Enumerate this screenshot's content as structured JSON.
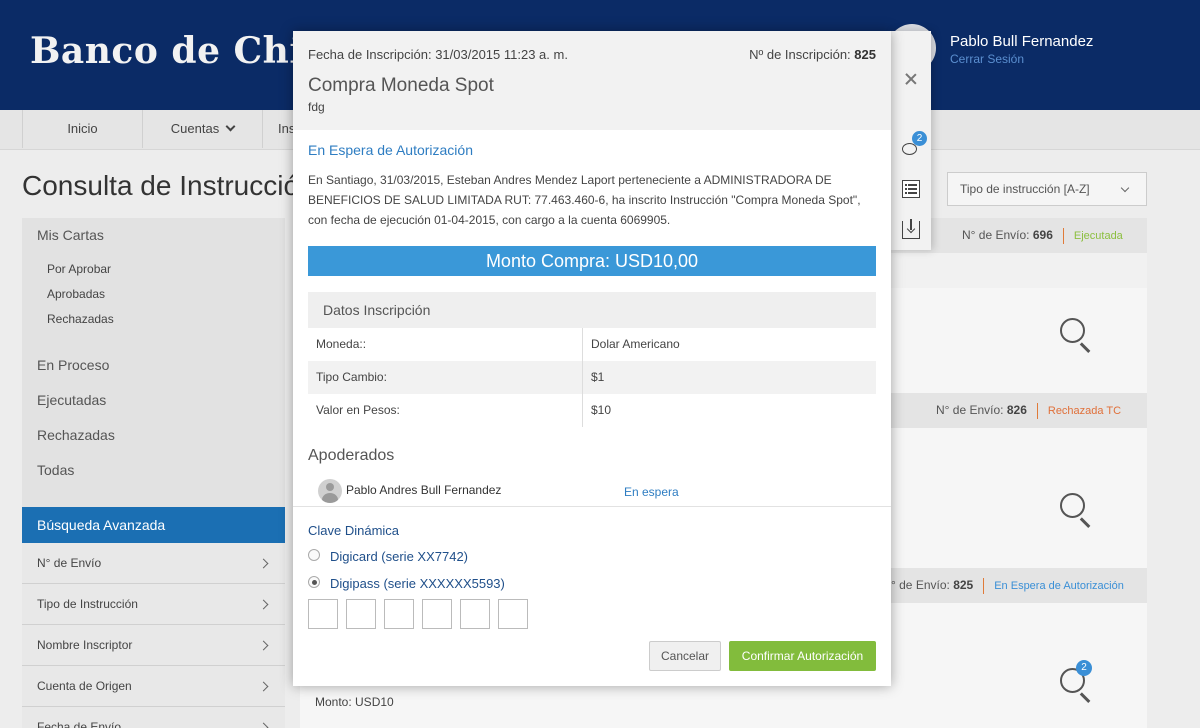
{
  "header": {
    "bank_name": "Banco de Chile",
    "user_name": "Pablo Bull Fernandez",
    "logout_label": "Cerrar Sesión"
  },
  "nav": {
    "items": [
      "Inicio",
      "Cuentas",
      "Ins"
    ]
  },
  "page": {
    "title": "Consulta de Instrucción",
    "filter_select": "Tipo de instrucción [A-Z]"
  },
  "sidebar": {
    "mis_cartas": "Mis Cartas",
    "sub_items": [
      "Por Aprobar",
      "Aprobadas",
      "Rechazadas"
    ],
    "groups": [
      "En Proceso",
      "Ejecutadas",
      "Rechazadas",
      "Todas"
    ],
    "advanced_title": "Búsqueda Avanzada",
    "advanced_items": [
      "N° de Envío",
      "Tipo de Instrucción",
      "Nombre Inscriptor",
      "Cuenta de Origen",
      "Fecha de Envío"
    ]
  },
  "cards": [
    {
      "envio_label": "N° de Envío:",
      "envio_num": "696",
      "status": "Ejecutada",
      "status_color": "#8cbf3f"
    },
    {
      "envio_label": "N° de Envío:",
      "envio_num": "826",
      "status": "Rechazada TC",
      "status_color": "#e0703a"
    },
    {
      "envio_label": "° de Envío:",
      "envio_num": "825",
      "status": "En Espera de Autorización",
      "status_color": "#3a8fd6"
    }
  ],
  "card_badge": "2",
  "background_monto": "Monto: USD10",
  "modal": {
    "fecha_label": "Fecha de Inscripción:",
    "fecha_value": "31/03/2015 11:23 a. m.",
    "num_label": "Nº de Inscripción:",
    "num_value": "825",
    "title": "Compra Moneda Spot",
    "subtitle": "fdg",
    "status": "En Espera de Autorización",
    "description": "En Santiago, 31/03/2015, Esteban Andres Mendez Laport perteneciente a ADMINISTRADORA DE BENEFICIOS DE SALUD LIMITADA RUT: 77.463.460-6, ha inscrito Instrucción \"Compra Moneda Spot\", con fecha de ejecución 01-04-2015, con cargo a la cuenta 6069905.",
    "amount_banner": "Monto Compra: USD10,00",
    "datos_title": "Datos Inscripción",
    "datos_rows": [
      {
        "key": "Moneda::",
        "value": "Dolar Americano"
      },
      {
        "key": "Tipo Cambio:",
        "value": "$1"
      },
      {
        "key": "Valor en Pesos:",
        "value": "$10"
      }
    ],
    "apoderados_title": "Apoderados",
    "apoderado": {
      "name": "Pablo Andres Bull Fernandez",
      "status": "En espera"
    },
    "clave_title": "Clave Dinámica",
    "options": [
      {
        "label": "Digicard (serie XX7742)",
        "selected": false
      },
      {
        "label": "Digipass (serie XXXXXX5593)",
        "selected": true
      }
    ],
    "cancel_label": "Cancelar",
    "confirm_label": "Confirmar Autorización",
    "comment_badge": "2"
  },
  "colors": {
    "brand_navy": "#0b2b66",
    "accent_blue": "#3a98d8",
    "confirm_green": "#82bc3c"
  }
}
